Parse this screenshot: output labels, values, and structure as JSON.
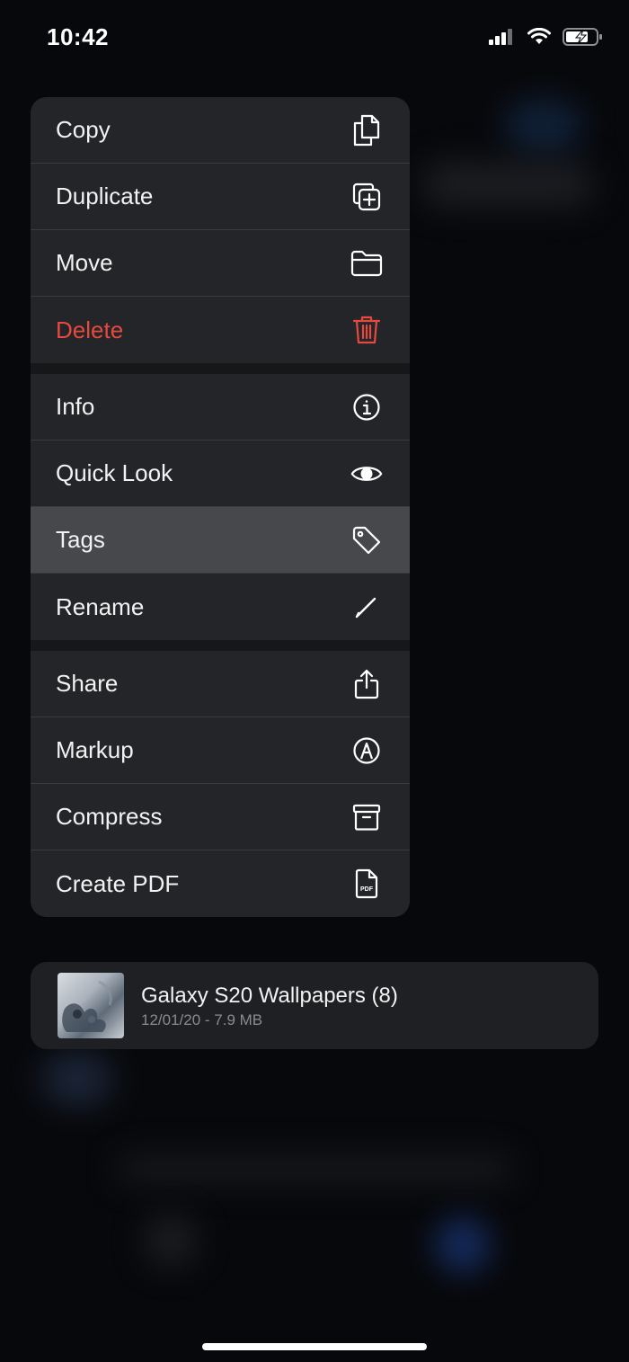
{
  "status_bar": {
    "time": "10:42",
    "icons": [
      "cellular-signal-icon",
      "wifi-icon",
      "battery-charging-icon"
    ]
  },
  "context_menu": {
    "groups": [
      [
        {
          "label": "Copy",
          "icon": "copy-icon"
        },
        {
          "label": "Duplicate",
          "icon": "duplicate-icon"
        },
        {
          "label": "Move",
          "icon": "folder-icon"
        },
        {
          "label": "Delete",
          "icon": "trash-icon",
          "destructive": true
        }
      ],
      [
        {
          "label": "Info",
          "icon": "info-icon"
        },
        {
          "label": "Quick Look",
          "icon": "eye-icon"
        },
        {
          "label": "Tags",
          "icon": "tag-icon",
          "highlighted": true
        },
        {
          "label": "Rename",
          "icon": "pencil-icon"
        }
      ],
      [
        {
          "label": "Share",
          "icon": "share-icon"
        },
        {
          "label": "Markup",
          "icon": "markup-icon"
        },
        {
          "label": "Compress",
          "icon": "archive-icon"
        },
        {
          "label": "Create PDF",
          "icon": "pdf-icon"
        }
      ]
    ]
  },
  "file_preview": {
    "name": "Galaxy S20 Wallpapers (8)",
    "meta": "12/01/20 - 7.9 MB",
    "thumbnail_icon": "folder-thumbnail-icon"
  },
  "colors": {
    "background": "#07080b",
    "menu_background": "#242528",
    "highlight": "#47484c",
    "destructive": "#e5493f"
  }
}
